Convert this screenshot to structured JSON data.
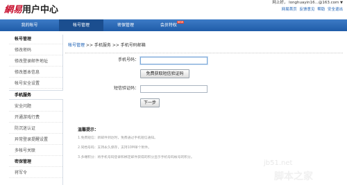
{
  "header": {
    "logo_brand": "網易",
    "logo_title": "用户中心",
    "user_prefix": "网上好，",
    "username": "longhuayin16...@163.com",
    "links": [
      "网易首页",
      "反馈意见",
      "帮助",
      "安全退出"
    ]
  },
  "nav": {
    "tabs": [
      "我的帐号",
      "帐号管理",
      "密保管理",
      "会员特权"
    ],
    "hot_badge": "NEW"
  },
  "sidebar": {
    "items": [
      {
        "label": "帐号管理"
      },
      {
        "label": "修改密码"
      },
      {
        "label": "修改登录邮件地址"
      },
      {
        "label": "修改基本信息"
      },
      {
        "label": "帐号安全设置"
      },
      {
        "label": "手机服务"
      },
      {
        "label": "安全问题"
      },
      {
        "label": "开通游戏行费"
      },
      {
        "label": "防沉迷认证"
      },
      {
        "label": "异常登录提醒设置"
      },
      {
        "label": "多帐号关联"
      },
      {
        "label": "密保管理"
      },
      {
        "label": "将军令"
      }
    ]
  },
  "breadcrumb": {
    "part1": "帐号管理",
    "sep": " >> ",
    "part2": "手机服务",
    "part3": "手机号码邮箱"
  },
  "form": {
    "phone_label": "手机号码：",
    "phone_value": "",
    "get_code_button": "免费获取短信验证码",
    "code_label": "短信验证码：",
    "code_value": "",
    "next_button": "下一步"
  },
  "tips": {
    "title": "温馨提示：",
    "lines": [
      "1.免费短信：新邮件到达时，免费通过手机短信通知。",
      "2.同档号码：支持永久保存，支持10M单个附件。",
      "3.多端积分：将手机号码登录和绑定邮件获得的积分显示手机号码帐号的积分。"
    ]
  },
  "watermark": {
    "line1": "jb51.net",
    "line2": "脚本之家"
  },
  "colors": {
    "brand_red": "#c8102e",
    "nav_blue": "#2a68b4",
    "link_blue": "#1a5fb4"
  }
}
